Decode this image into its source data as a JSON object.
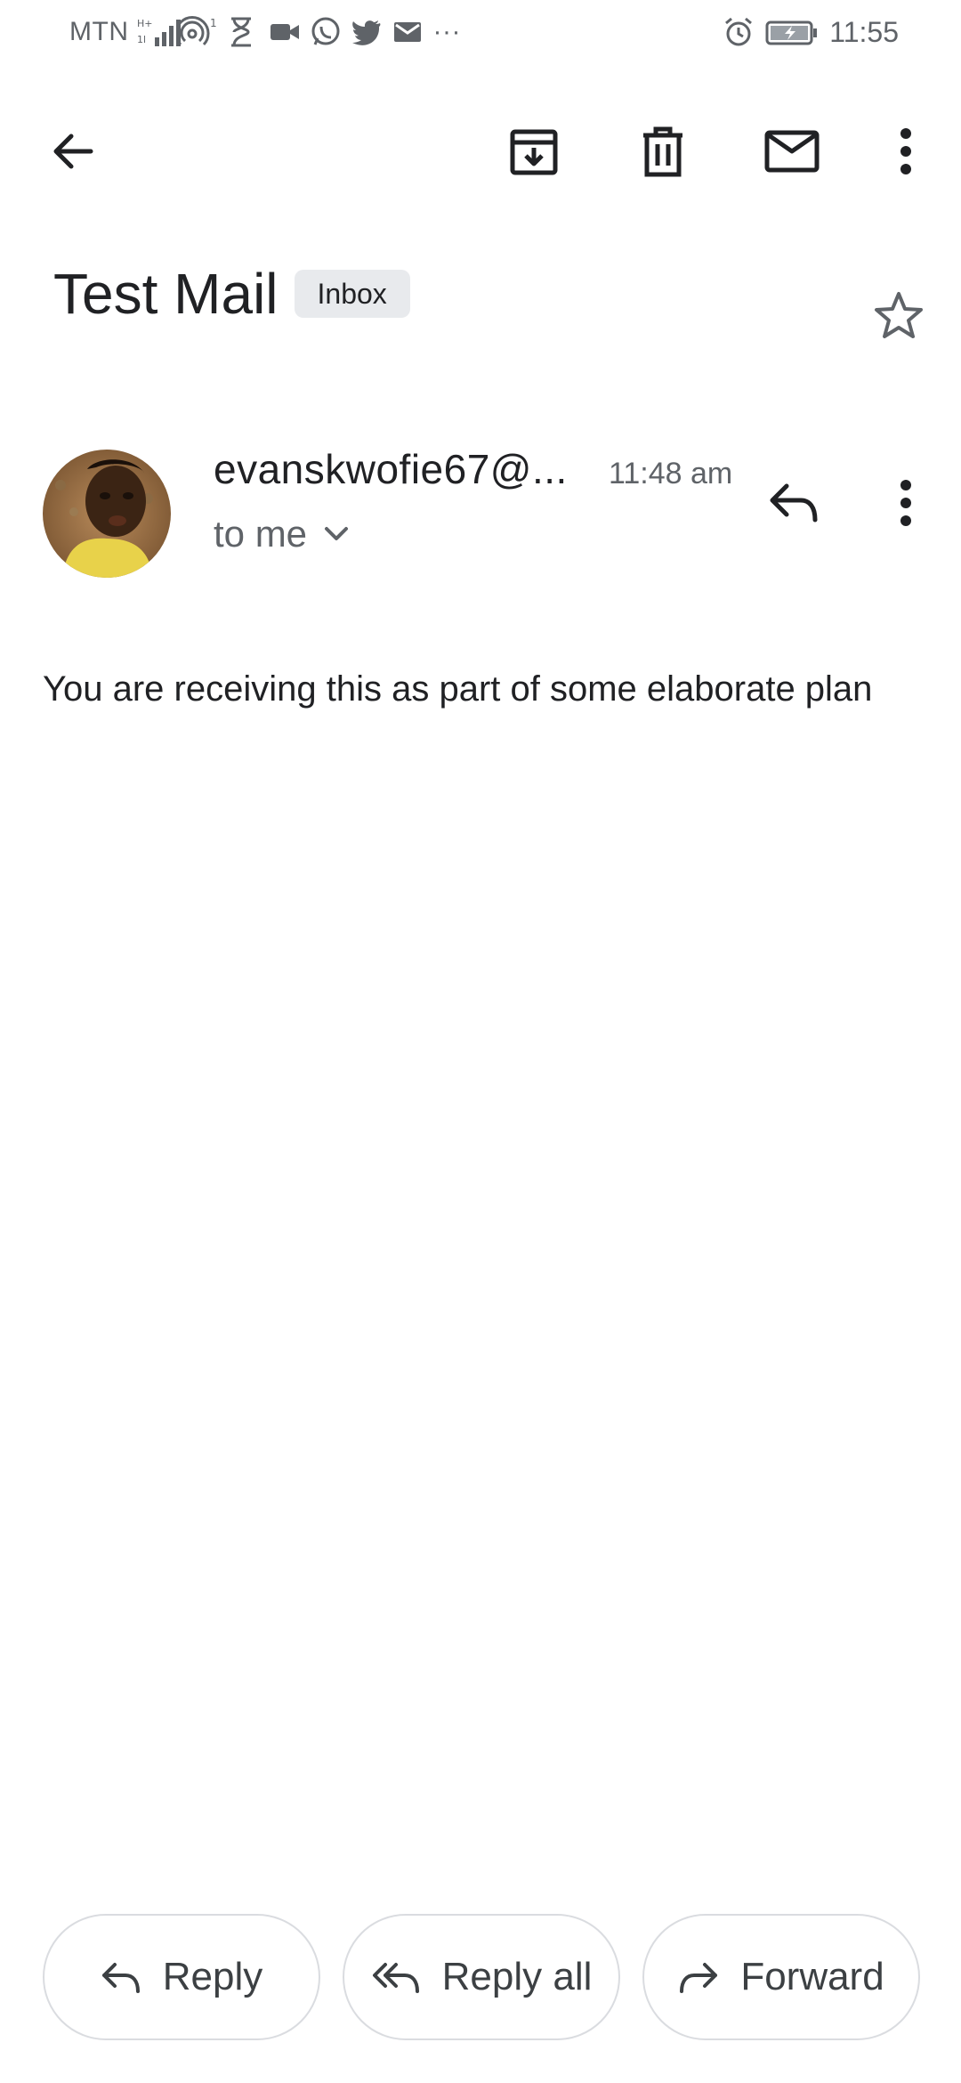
{
  "status_bar": {
    "carrier": "MTN",
    "hotspot_count": "1",
    "overflow": "···",
    "time": "11:55",
    "icons": [
      "signal-icon",
      "hotspot-icon",
      "hourglass-icon",
      "video-icon",
      "whatsapp-icon",
      "twitter-icon",
      "mail-icon",
      "alarm-icon",
      "battery-icon"
    ]
  },
  "toolbar": {
    "icons": [
      "back-arrow-icon",
      "archive-icon",
      "delete-icon",
      "mark-unread-icon",
      "more-vert-icon"
    ]
  },
  "email": {
    "subject": "Test Mail",
    "label": "Inbox",
    "sender": "evanskwofie67@...",
    "time": "11:48 am",
    "recipients": "to me",
    "body": "You are receiving this as part of some elaborate plan"
  },
  "actions": {
    "reply": "Reply",
    "reply_all": "Reply all",
    "forward": "Forward"
  },
  "colors": {
    "text_primary": "#202124",
    "text_secondary": "#5f6368",
    "chip_bg": "#e8eaed",
    "button_border": "#dadce0"
  }
}
